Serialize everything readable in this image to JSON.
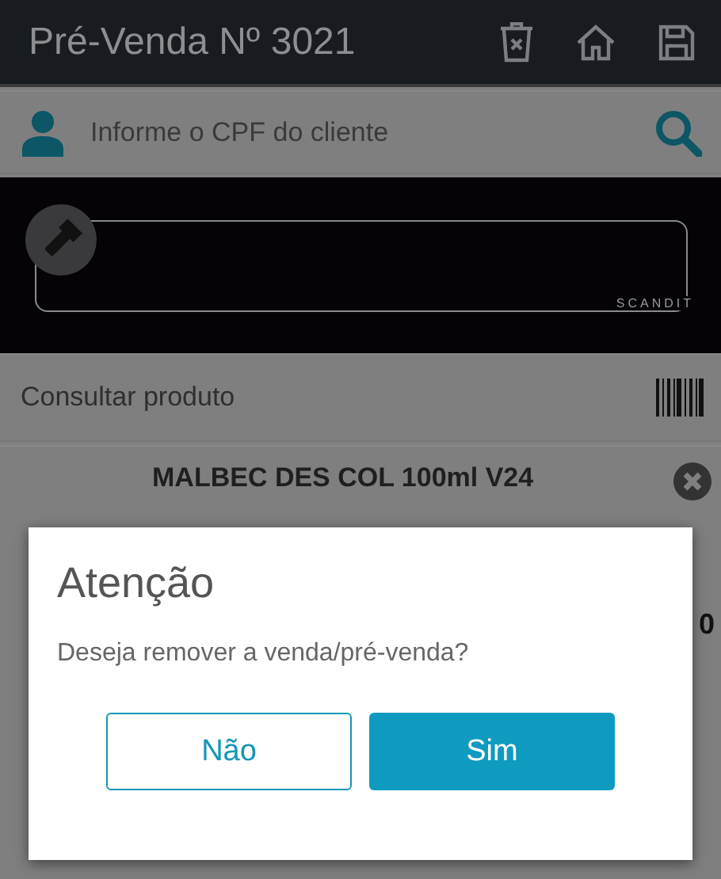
{
  "app_bar": {
    "title": "Pré-Venda Nº 3021"
  },
  "customer_search": {
    "placeholder": "Informe o CPF do cliente"
  },
  "scanner": {
    "brand": "SCANDIT"
  },
  "product_search": {
    "placeholder": "Consultar produto"
  },
  "product": {
    "name": "MALBEC DES COL 100ml V24",
    "quantity": "0"
  },
  "dialog": {
    "title": "Atenção",
    "message": "Deseja remover a venda/pré-venda?",
    "buttons": [
      {
        "label": "Não",
        "kind": "outline"
      },
      {
        "label": "Sim",
        "kind": "primary"
      }
    ]
  }
}
